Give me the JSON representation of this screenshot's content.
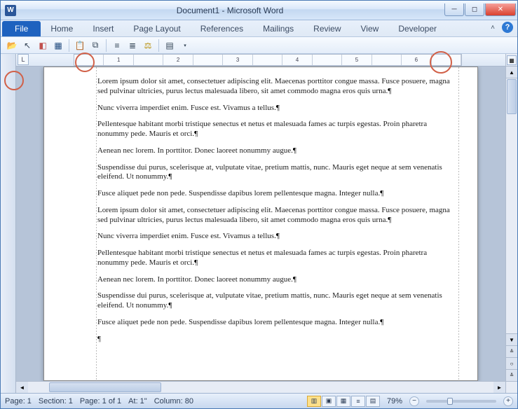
{
  "title": "Document1 - Microsoft Word",
  "app_icon_letter": "W",
  "ribbon": {
    "file": "File",
    "tabs": [
      "Home",
      "Insert",
      "Page Layout",
      "References",
      "Mailings",
      "Review",
      "View",
      "Developer"
    ]
  },
  "hruler_ticks": [
    "",
    "1",
    "",
    "2",
    "",
    "3",
    "",
    "4",
    "",
    "5",
    "",
    "6",
    ""
  ],
  "tab_stop_label": "L",
  "document": {
    "paragraphs": [
      "Lorem ipsum dolor sit amet, consectetuer adipiscing elit. Maecenas porttitor congue massa. Fusce posuere, magna sed pulvinar ultricies, purus lectus malesuada libero, sit amet commodo magna eros quis urna.",
      "Nunc viverra imperdiet enim. Fusce est. Vivamus a tellus.",
      "Pellentesque habitant morbi tristique senectus et netus et malesuada fames ac turpis egestas. Proin pharetra nonummy pede. Mauris et orci.",
      "Aenean nec lorem. In porttitor. Donec laoreet nonummy augue.",
      "Suspendisse dui purus, scelerisque at, vulputate vitae, pretium mattis, nunc. Mauris eget neque at sem venenatis eleifend. Ut nonummy.",
      "Fusce aliquet pede non pede. Suspendisse dapibus lorem pellentesque magna. Integer nulla.",
      "Lorem ipsum dolor sit amet, consectetuer adipiscing elit. Maecenas porttitor congue massa. Fusce posuere, magna sed pulvinar ultricies, purus lectus malesuada libero, sit amet commodo magna eros quis urna.",
      "Nunc viverra imperdiet enim. Fusce est. Vivamus a tellus.",
      "Pellentesque habitant morbi tristique senectus et netus et malesuada fames ac turpis egestas. Proin pharetra nonummy pede. Mauris et orci.",
      "Aenean nec lorem. In porttitor. Donec laoreet nonummy augue.",
      "Suspendisse dui purus, scelerisque at, vulputate vitae, pretium mattis, nunc. Mauris eget neque at sem venenatis eleifend. Ut nonummy.",
      "Fusce aliquet pede non pede. Suspendisse dapibus lorem pellentesque magna. Integer nulla."
    ]
  },
  "status": {
    "page": "Page: 1",
    "section": "Section: 1",
    "page_of": "Page: 1 of 1",
    "at": "At: 1\"",
    "column": "Column: 80",
    "zoom": "79%"
  }
}
